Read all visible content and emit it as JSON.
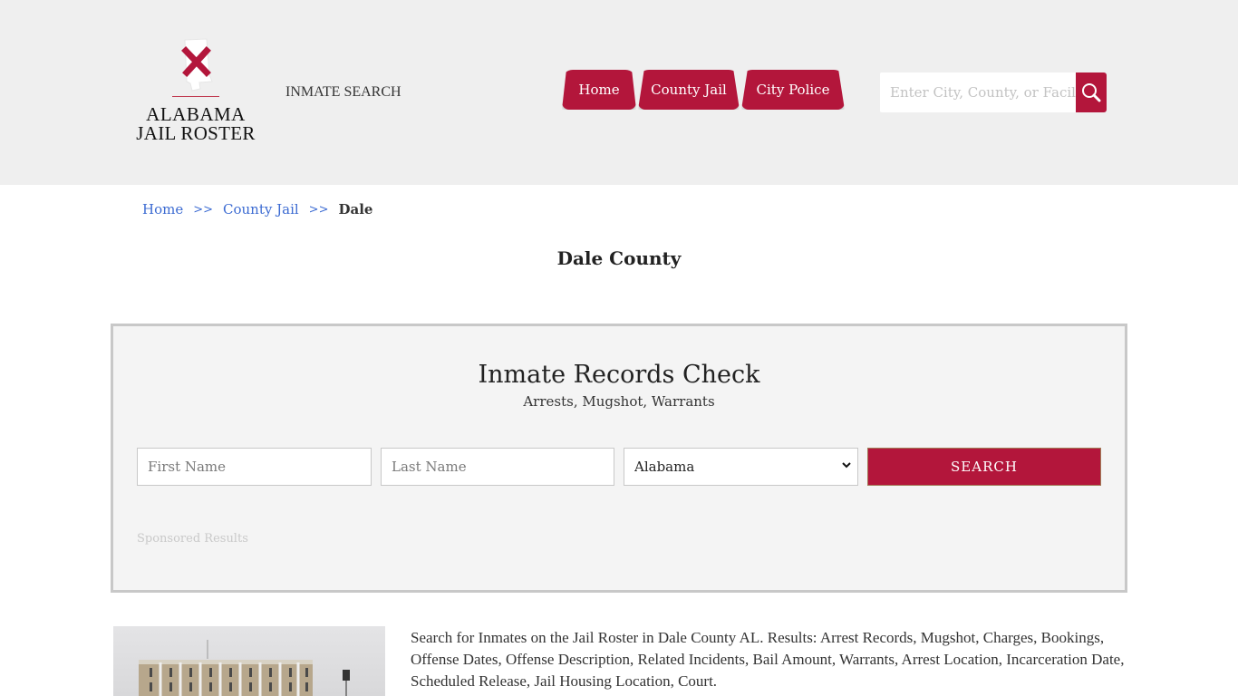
{
  "header": {
    "logo": {
      "line1": "ALABAMA",
      "line2": "JAIL ROSTER",
      "dots": "•••"
    },
    "inmate_search_link": "INMATE SEARCH",
    "nav": [
      {
        "label": "Home"
      },
      {
        "label": "County Jail"
      },
      {
        "label": "City Police"
      }
    ],
    "site_search": {
      "placeholder": "Enter City, County, or Facility",
      "icon": "search-icon"
    }
  },
  "breadcrumb": {
    "items": [
      {
        "label": "Home"
      },
      {
        "label": "County Jail"
      }
    ],
    "separator": ">>",
    "current": "Dale"
  },
  "page": {
    "title": "Dale County"
  },
  "records_check": {
    "title": "Inmate Records Check",
    "subtitle": "Arrests, Mugshot, Warrants",
    "first_name_placeholder": "First Name",
    "last_name_placeholder": "Last Name",
    "state_selected": "Alabama",
    "search_label": "SEARCH",
    "sponsored_label": "Sponsored Results"
  },
  "content": {
    "image_alt": "Lauderdale County Court House",
    "description": "Search for Inmates on the Jail Roster in Dale County AL. Results: Arrest Records, Mugshot, Charges, Bookings, Offense Dates, Offense Description, Related Incidents, Bail Amount, Warrants, Arrest Location, Incarceration Date, Scheduled Release, Jail Housing Location, Court."
  },
  "colors": {
    "brand_red": "#b3163b",
    "link_blue": "#3c6bd2",
    "header_bg": "#efefef"
  }
}
